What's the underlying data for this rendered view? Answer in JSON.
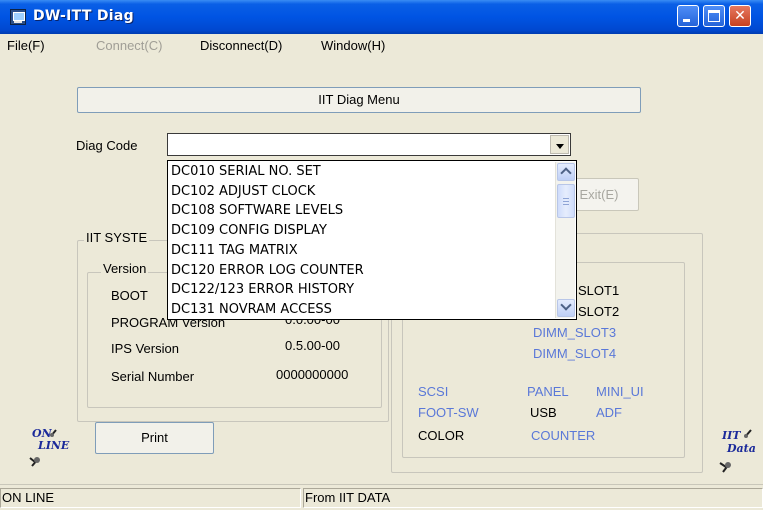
{
  "window": {
    "title": "DW-ITT Diag",
    "buttons": {
      "minimize": "minimize-icon",
      "maximize": "maximize-icon",
      "close": "close-icon"
    }
  },
  "menu": {
    "items": [
      {
        "label": "File(F)",
        "enabled": true
      },
      {
        "label": "Connect(C)",
        "enabled": false
      },
      {
        "label": "Disconnect(D)",
        "enabled": true
      },
      {
        "label": "Window(H)",
        "enabled": true
      }
    ]
  },
  "header_button": "IIT Diag Menu",
  "diag_code": {
    "label": "Diag Code",
    "value": "",
    "options": [
      "DC010 SERIAL NO. SET",
      "DC102 ADJUST CLOCK",
      "DC108 SOFTWARE LEVELS",
      "DC109 CONFIG DISPLAY",
      "DC111 TAG MATRIX",
      "DC120 ERROR LOG COUNTER",
      "DC122/123 ERROR HISTORY",
      "DC131 NOVRAM ACCESS"
    ]
  },
  "exit_button": "Exit(E)",
  "iit_system": {
    "legend": "IIT SYSTE",
    "version_legend": "Version",
    "rows": [
      {
        "label": "BOOT",
        "value": ""
      },
      {
        "label": "PROGRAM Version",
        "value": "0.0.00-00"
      },
      {
        "label": "IPS Version",
        "value": "0.5.00-00"
      },
      {
        "label": "Serial Number",
        "value": "0000000000"
      }
    ]
  },
  "options_panel": {
    "slots": [
      {
        "label": "SLOT1",
        "active": true
      },
      {
        "label": "SLOT2",
        "active": true
      },
      {
        "label": "DIMM_SLOT3",
        "active": false
      },
      {
        "label": "DIMM_SLOT4",
        "active": false
      }
    ],
    "items": [
      {
        "label": "SCSI",
        "active": false
      },
      {
        "label": "PANEL",
        "active": false
      },
      {
        "label": "MINI_UI",
        "active": false
      },
      {
        "label": "FOOT-SW",
        "active": false
      },
      {
        "label": "USB",
        "active": true
      },
      {
        "label": "ADF",
        "active": false
      },
      {
        "label": "COLOR",
        "active": true
      },
      {
        "label": "COUNTER",
        "active": false
      }
    ]
  },
  "print_button": "Print",
  "badges": {
    "online": {
      "line1": "ON",
      "line2": "LINE"
    },
    "iit_data": {
      "line1": "IIT",
      "line2": "Data"
    }
  },
  "colors": {
    "titlebar": "#0054e3",
    "active_text": "#000000",
    "inactive_text": "#5a78d8"
  },
  "status": {
    "left": "ON LINE",
    "right": "From IIT DATA"
  }
}
